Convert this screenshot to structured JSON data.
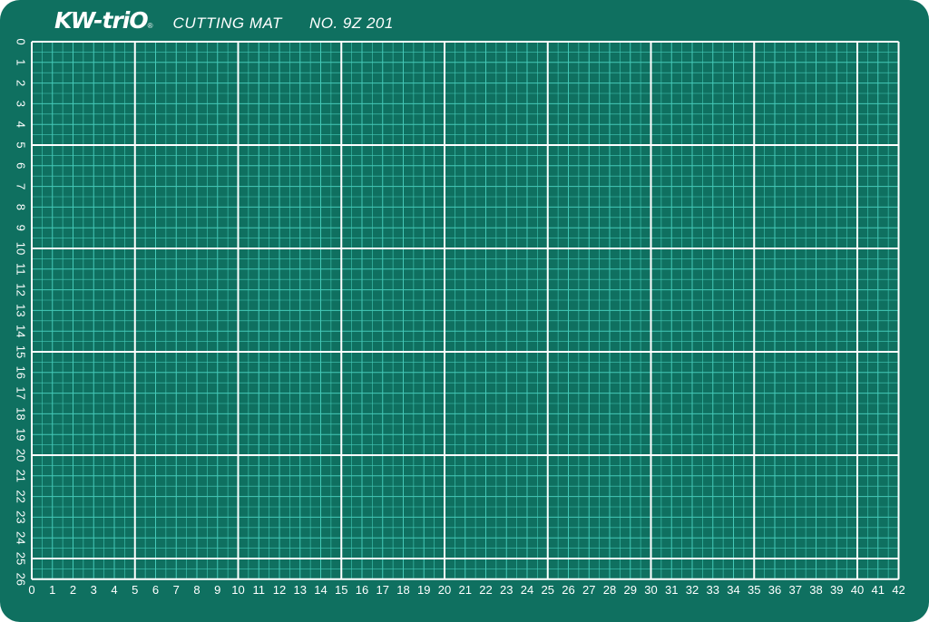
{
  "brand": {
    "logo_text": "KW-triO",
    "registered_mark": "®"
  },
  "product": {
    "name": "CUTTING MAT",
    "number": "NO. 9Z 201"
  },
  "ruler": {
    "unit": "cm",
    "x_range": [
      0,
      42
    ],
    "y_range": [
      0,
      26
    ],
    "major_every": 5,
    "subdivisions_per_unit": 2
  },
  "colors": {
    "mat_green": "#0f7060",
    "minor_line": "#45c9b8",
    "major_line": "#ffffff",
    "text": "#ffffff"
  }
}
